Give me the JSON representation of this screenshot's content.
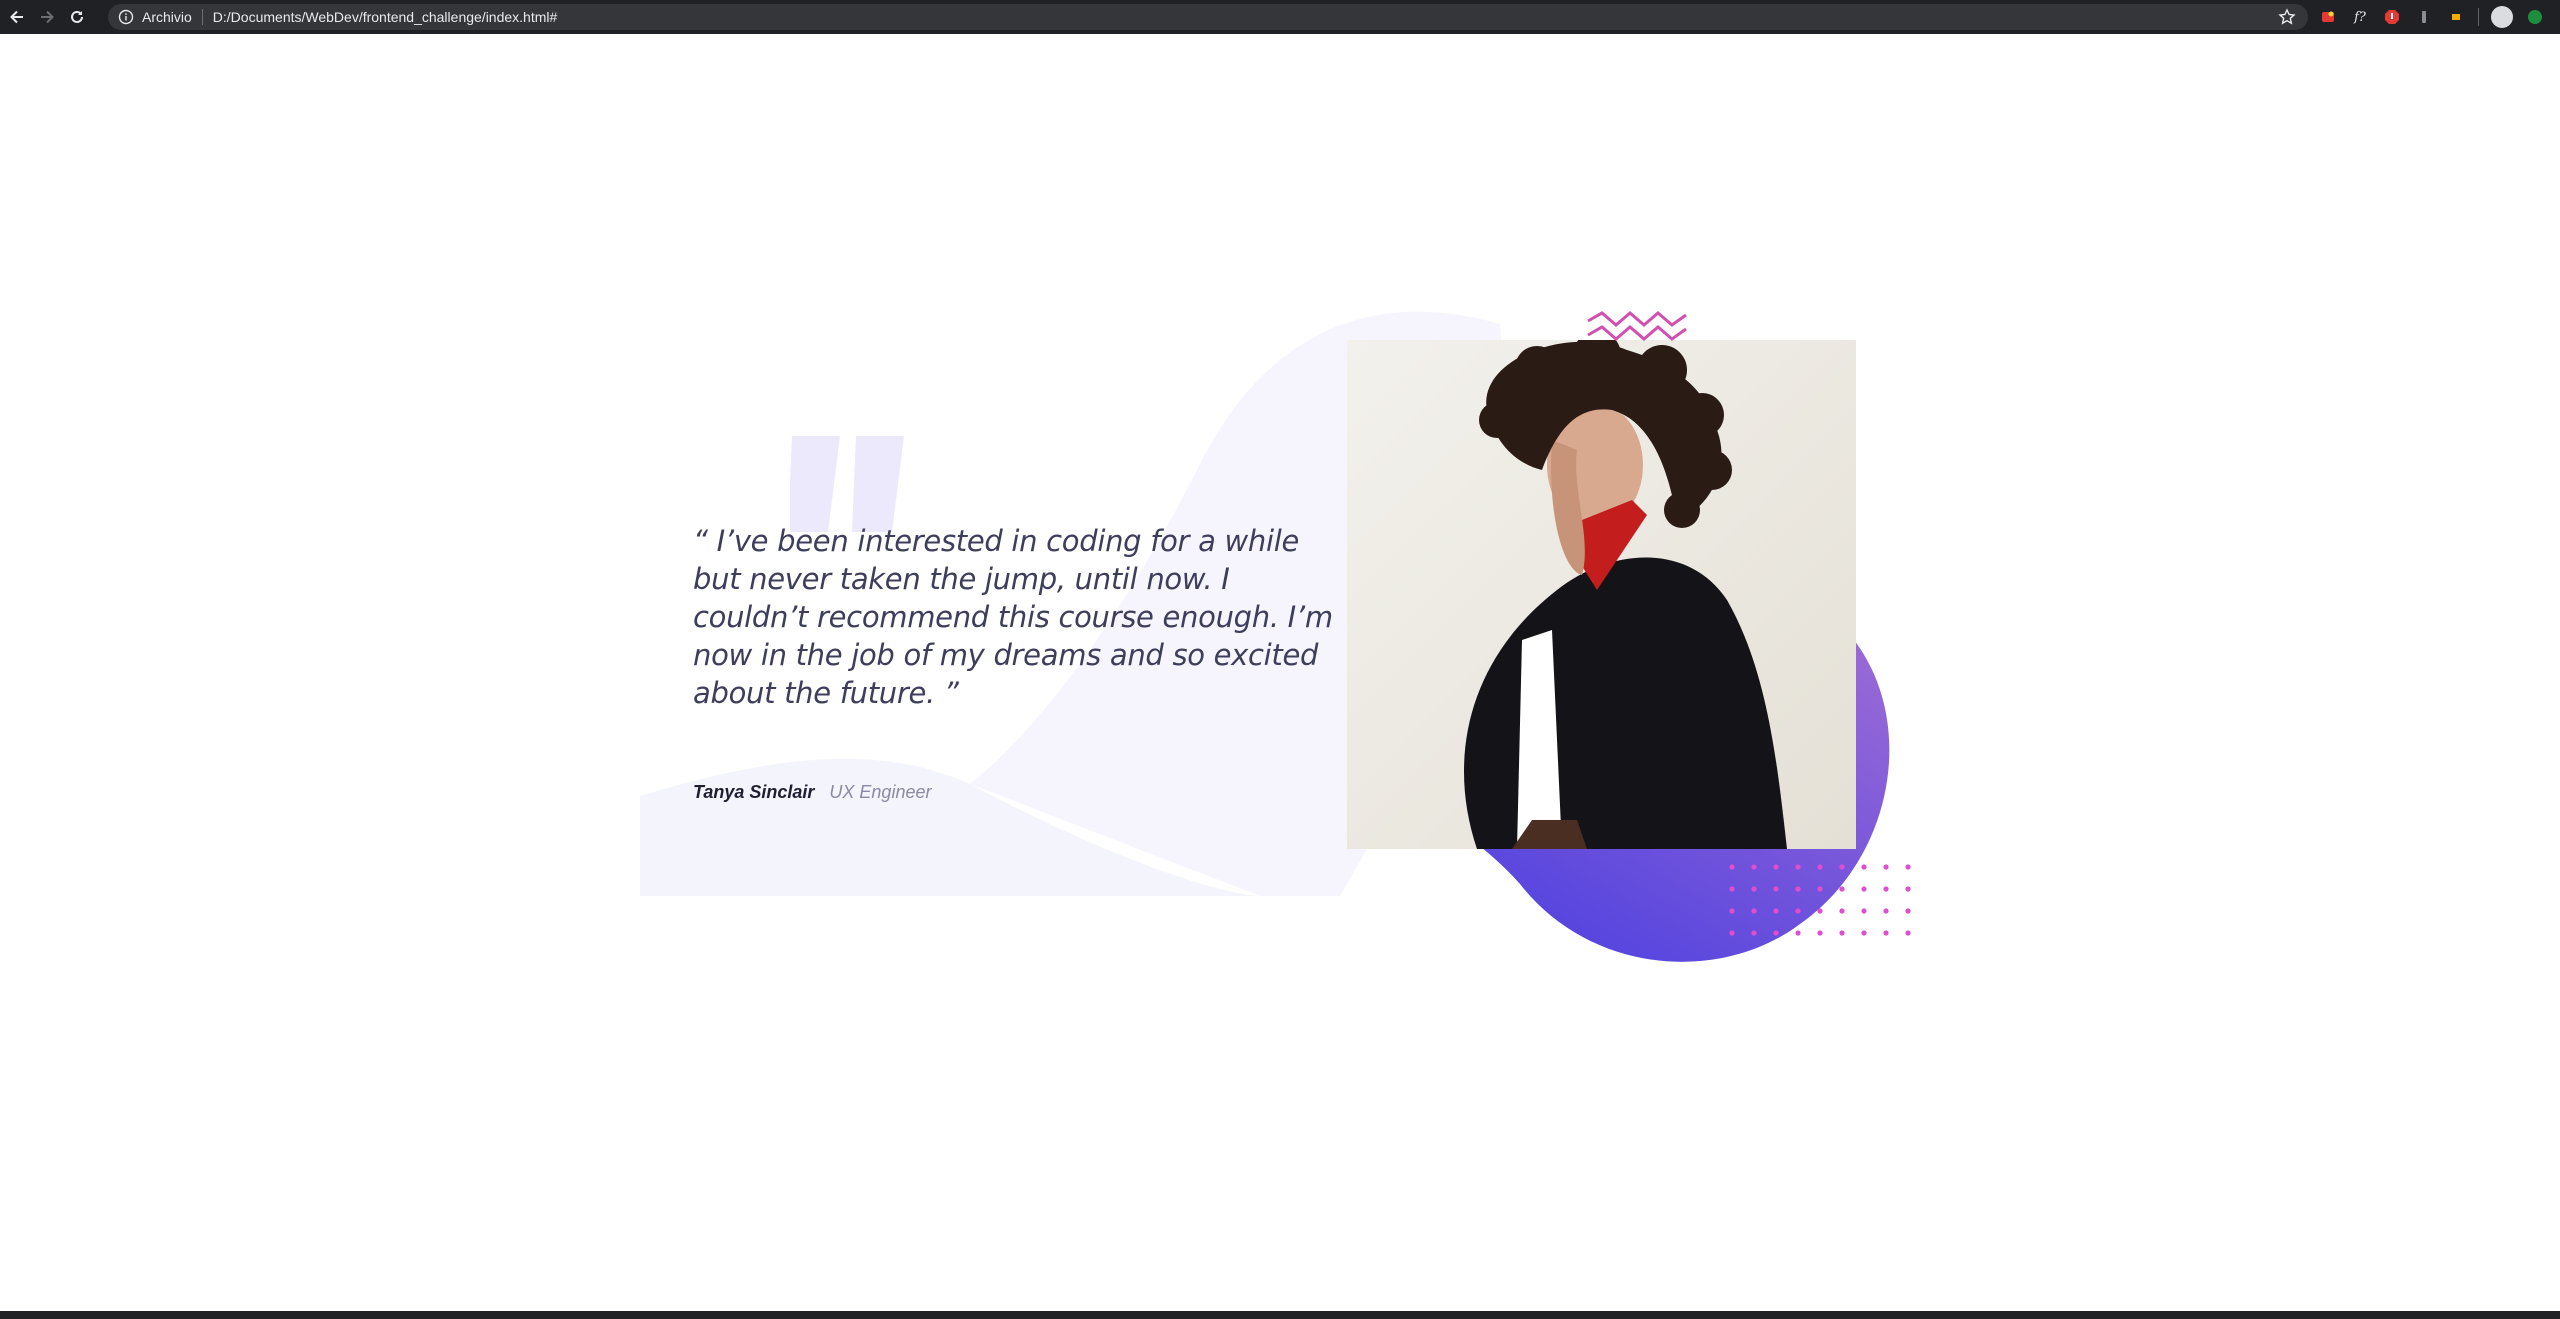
{
  "browser": {
    "site_info": "Archivio",
    "url": "D:/Documents/WebDev/frontend_challenge/index.html#",
    "icons": [
      "back-icon",
      "forward-icon",
      "reload-icon",
      "info-icon",
      "bookmark-star-icon",
      "extension-icons",
      "profile-avatar",
      "update-icon"
    ]
  },
  "testimonial": {
    "quote": "“ I’ve been interested in coding for a while but never taken the jump, until now. I couldn’t recommend this course enough. I’m now in the job of my dreams and so excited about the future. ”",
    "author_name": "Tanya Sinclair",
    "author_role": "UX Engineer"
  },
  "colors": {
    "chrome_bg": "#202124",
    "omnibox_bg": "#35363a",
    "quote_text": "#3d3d5c",
    "role_text": "#8a8aa3",
    "accent_pink": "#e04ecf",
    "blob_start": "#4b3fe0",
    "blob_end": "#9a6ad6",
    "curve_bg": "#f4f4fc"
  }
}
